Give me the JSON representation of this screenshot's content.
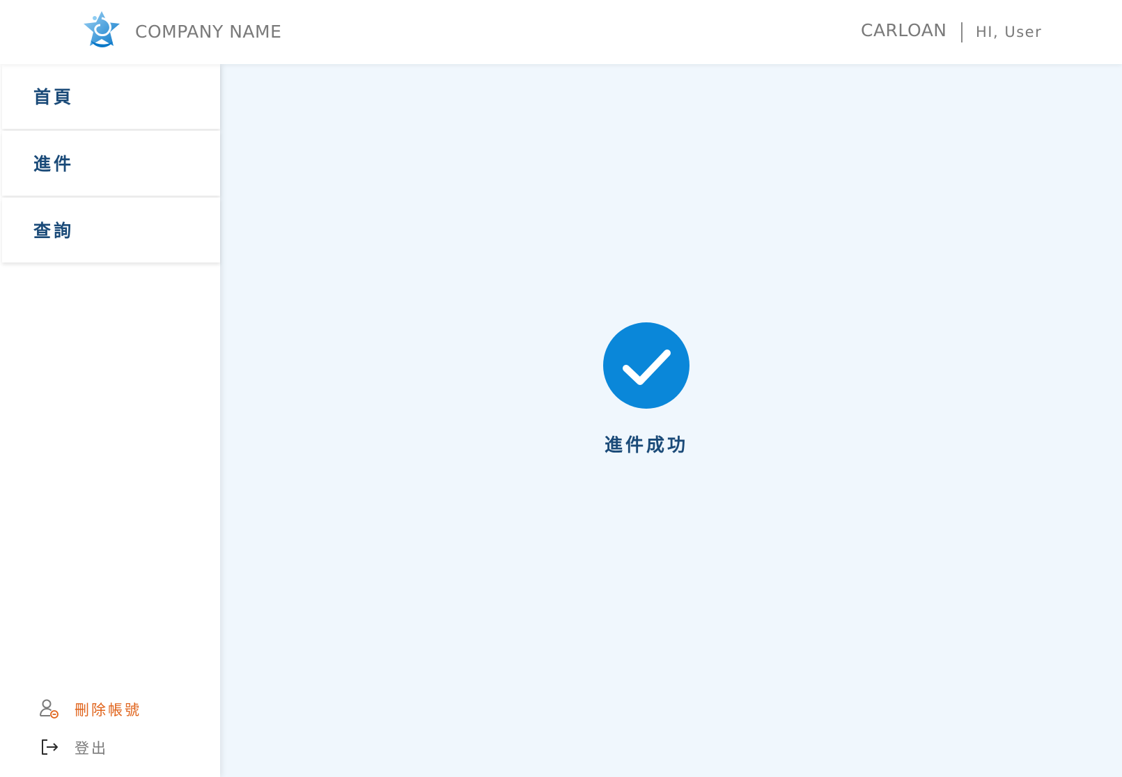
{
  "header": {
    "company_name": "COMPANY NAME",
    "product_name": "CARLOAN",
    "greeting": "HI, User",
    "logo_icon": "company-logo-icon"
  },
  "sidebar": {
    "items": [
      {
        "label": "首頁"
      },
      {
        "label": "進件"
      },
      {
        "label": "查詢"
      }
    ],
    "delete_account": {
      "label": "刪除帳號",
      "icon": "user-remove-icon",
      "color": "#e0641c"
    },
    "logout": {
      "label": "登出",
      "icon": "logout-icon",
      "color": "#7a7a7a"
    }
  },
  "main": {
    "status_icon": "check-circle-icon",
    "status_text": "進件成功",
    "accent_color": "#0a87d9"
  },
  "theme": {
    "nav_text_color": "#1a4a78",
    "main_background": "#f0f7fd"
  }
}
